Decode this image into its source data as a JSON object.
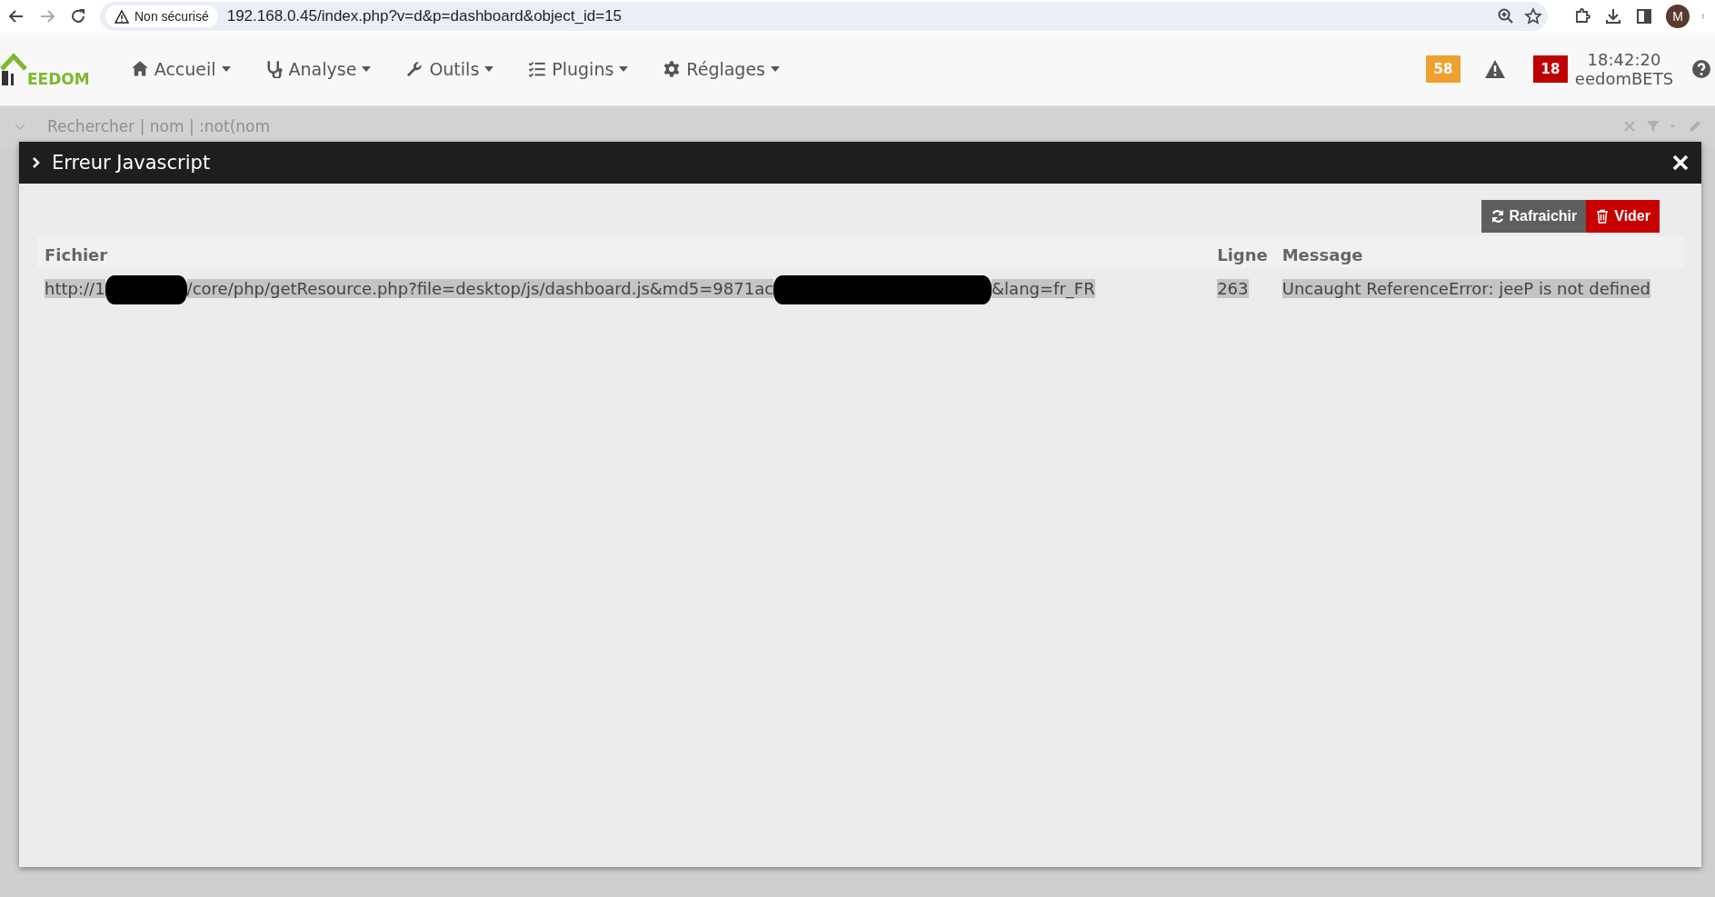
{
  "browser": {
    "security": "Non sécurisé",
    "url": "192.168.0.45/index.php?v=d&p=dashboard&object_id=15",
    "profile": "M"
  },
  "navbar": {
    "logo": "EEDOM",
    "menus": [
      {
        "label": "Accueil",
        "kind": "home"
      },
      {
        "label": "Analyse",
        "kind": "stethoscope"
      },
      {
        "label": "Outils",
        "kind": "wrench"
      },
      {
        "label": "Plugins",
        "kind": "tasks"
      },
      {
        "label": "Réglages",
        "kind": "cog"
      }
    ],
    "badges": [
      {
        "count": "58",
        "color": "#f0a030"
      },
      {
        "count": "18",
        "color": "#c00000"
      }
    ],
    "time": "18:42:20",
    "system": "eedomBETS"
  },
  "search": {
    "placeholder": "Rechercher | nom | :not(nom"
  },
  "modal": {
    "title": "Erreur Javascript",
    "buttons": [
      {
        "label": "Rafraichir",
        "kind": "refresh"
      },
      {
        "label": "Vider",
        "kind": "clear"
      }
    ],
    "table": {
      "columns": [
        "Fichier",
        "Ligne",
        "Message"
      ],
      "rows": [
        {
          "file_parts": [
            "http://1",
            "/core/php/getResource.php?file=desktop/js/dashboard.js&md5=9871ac",
            "&lang=fr_FR"
          ],
          "line": "263",
          "message": "Uncaught ReferenceError: jeeP is not defined"
        }
      ]
    }
  }
}
